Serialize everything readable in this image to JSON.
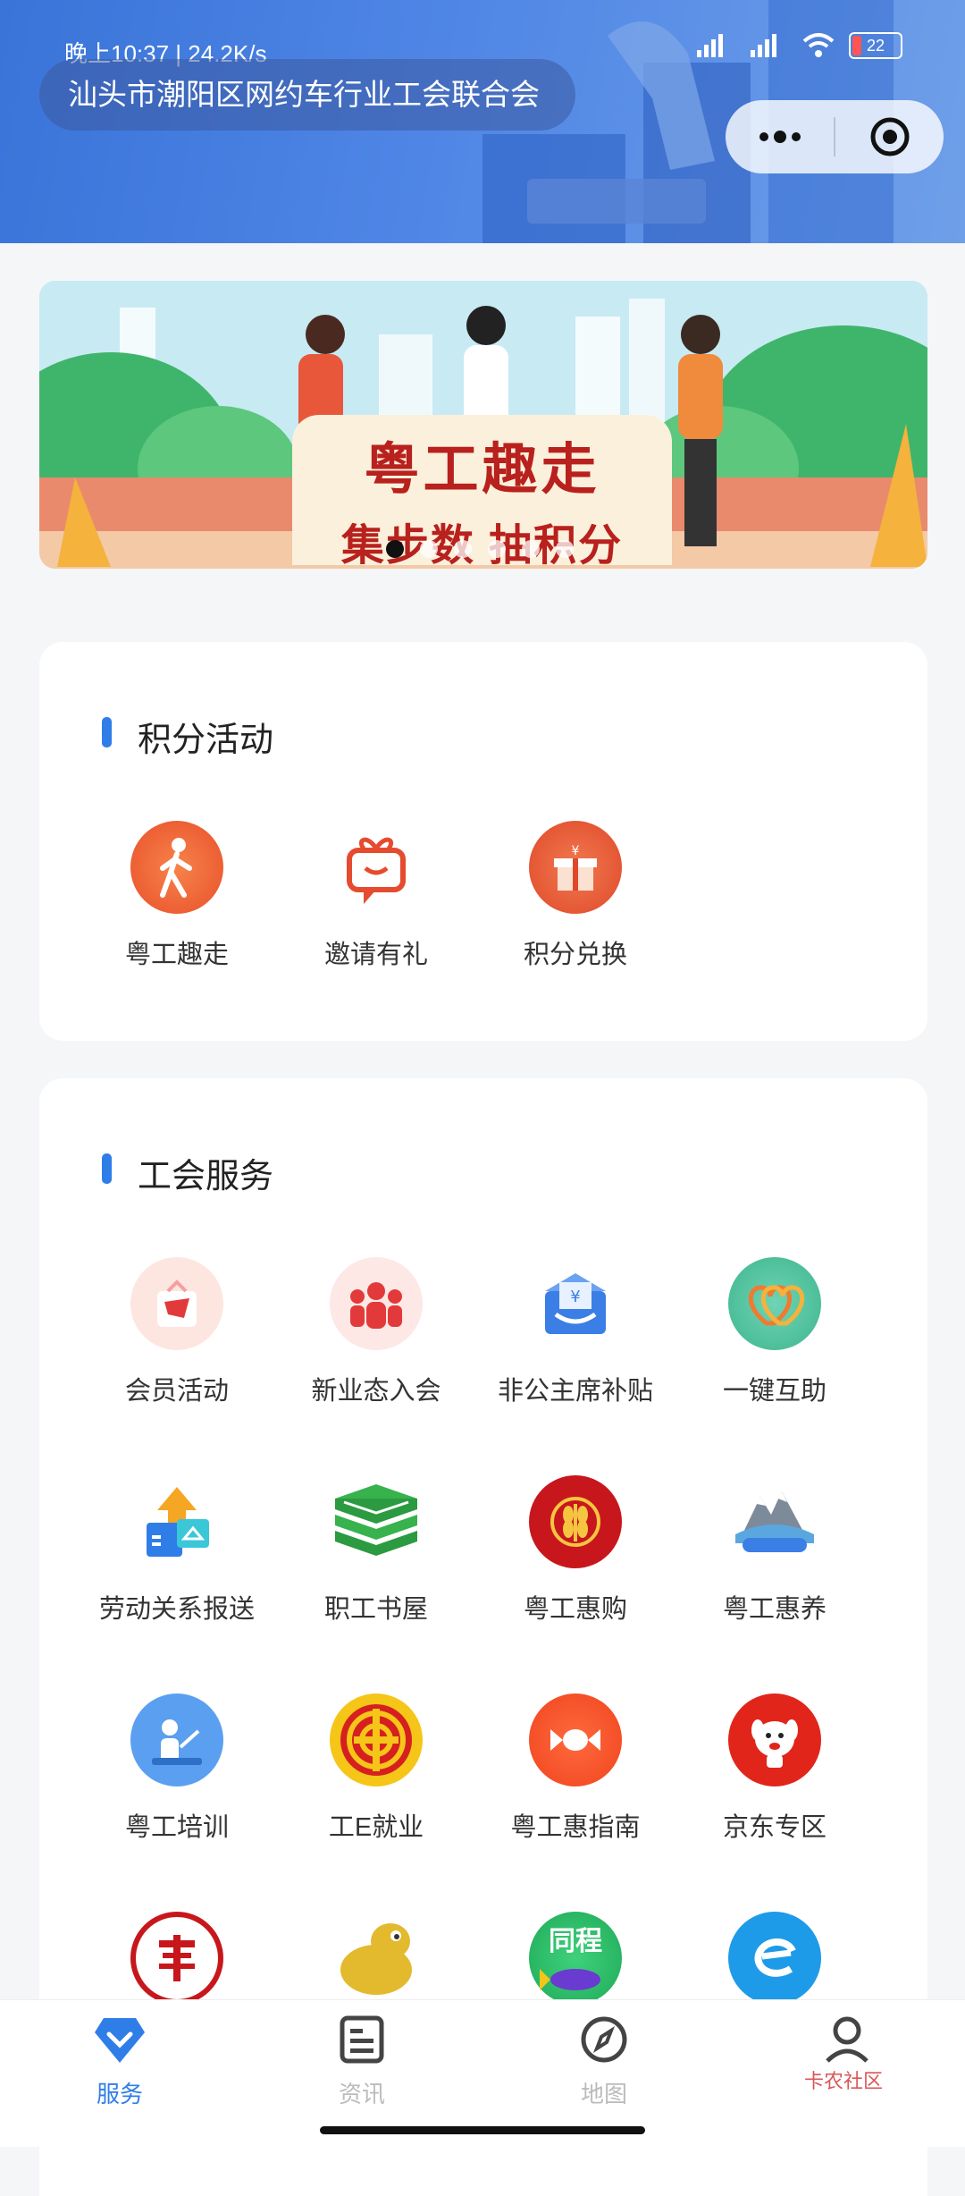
{
  "status_bar": {
    "time": "晚上10:37",
    "speed": "24.2K/s",
    "battery": "22"
  },
  "header": {
    "title": "汕头市潮阳区网约车行业工会联合会"
  },
  "banner": {
    "title": "粤工趣走",
    "subtitle": "集步数 抽积分",
    "slide_count": 6,
    "active_index": 0
  },
  "points_section": {
    "title": "积分活动",
    "items": [
      {
        "label": "粤工趣走",
        "icon": "walking-icon"
      },
      {
        "label": "邀请有礼",
        "icon": "gift-invite-icon"
      },
      {
        "label": "积分兑换",
        "icon": "points-exchange-icon"
      }
    ]
  },
  "service_section": {
    "title": "工会服务",
    "items": [
      {
        "label": "会员活动",
        "icon": "member-activity-icon"
      },
      {
        "label": "新业态入会",
        "icon": "new-member-icon"
      },
      {
        "label": "非公主席补贴",
        "icon": "subsidy-envelope-icon"
      },
      {
        "label": "一键互助",
        "icon": "mutual-aid-hearts-icon"
      },
      {
        "label": "劳动关系报送",
        "icon": "labor-report-icon"
      },
      {
        "label": "职工书屋",
        "icon": "books-icon"
      },
      {
        "label": "粤工惠购",
        "icon": "wheat-shop-icon"
      },
      {
        "label": "粤工惠养",
        "icon": "retreat-mountain-icon"
      },
      {
        "label": "粤工培训",
        "icon": "training-icon"
      },
      {
        "label": "工E就业",
        "icon": "union-emblem-icon"
      },
      {
        "label": "粤工惠指南",
        "icon": "candy-guide-icon"
      },
      {
        "label": "京东专区",
        "icon": "jd-dog-icon"
      },
      {
        "label": "",
        "icon": "seal-icon"
      },
      {
        "label": "",
        "icon": "frog-icon"
      },
      {
        "label": "",
        "icon": "tongcheng-icon"
      },
      {
        "label": "",
        "icon": "e-logo-icon"
      }
    ],
    "partial_texts": {
      "tongcheng": "同程"
    }
  },
  "tabbar": {
    "tabs": [
      {
        "label": "服务",
        "active": true
      },
      {
        "label": "资讯",
        "active": false
      },
      {
        "label": "地图",
        "active": false
      },
      {
        "label": "",
        "active": false
      }
    ]
  },
  "watermark": "卡农社区",
  "colors": {
    "accent": "#2f7ee8",
    "header": "#3a74d8",
    "inactive_tab": "#bbbbbb"
  }
}
